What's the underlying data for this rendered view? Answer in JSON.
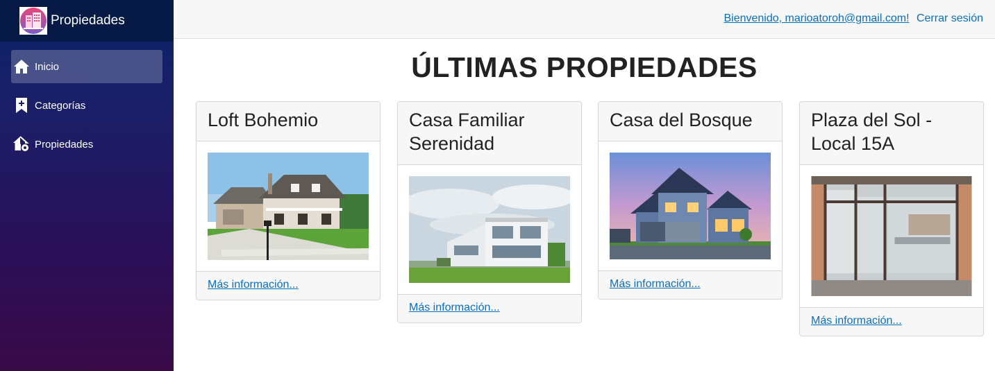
{
  "brand": {
    "name": "Propiedades",
    "logo_icon": "building-logo-icon"
  },
  "sidebar": {
    "items": [
      {
        "label": "Inicio",
        "icon": "home-icon",
        "active": true
      },
      {
        "label": "Categorías",
        "icon": "bookmark-plus-icon",
        "active": false
      },
      {
        "label": "Propiedades",
        "icon": "house-gear-icon",
        "active": false
      }
    ]
  },
  "header": {
    "welcome": "Bienvenido, marioatoroh@gmail.com!",
    "logout": "Cerrar sesión"
  },
  "main": {
    "title": "ÚLTIMAS PROPIEDADES",
    "cards": [
      {
        "title": "Loft Bohemio",
        "image": "house-photo-suburban",
        "link": "Más información..."
      },
      {
        "title": "Casa Familiar Serenidad",
        "image": "house-photo-modern-white",
        "link": "Más información..."
      },
      {
        "title": "Casa del Bosque",
        "image": "house-photo-dusk",
        "link": "Más información..."
      },
      {
        "title": "Plaza del Sol - Local 15A",
        "image": "storefront-photo-glass",
        "link": "Más información..."
      }
    ]
  },
  "colors": {
    "link": "#0a6ebd",
    "sidebar_top": "#0b2467",
    "sidebar_bottom": "#3a0a47"
  }
}
